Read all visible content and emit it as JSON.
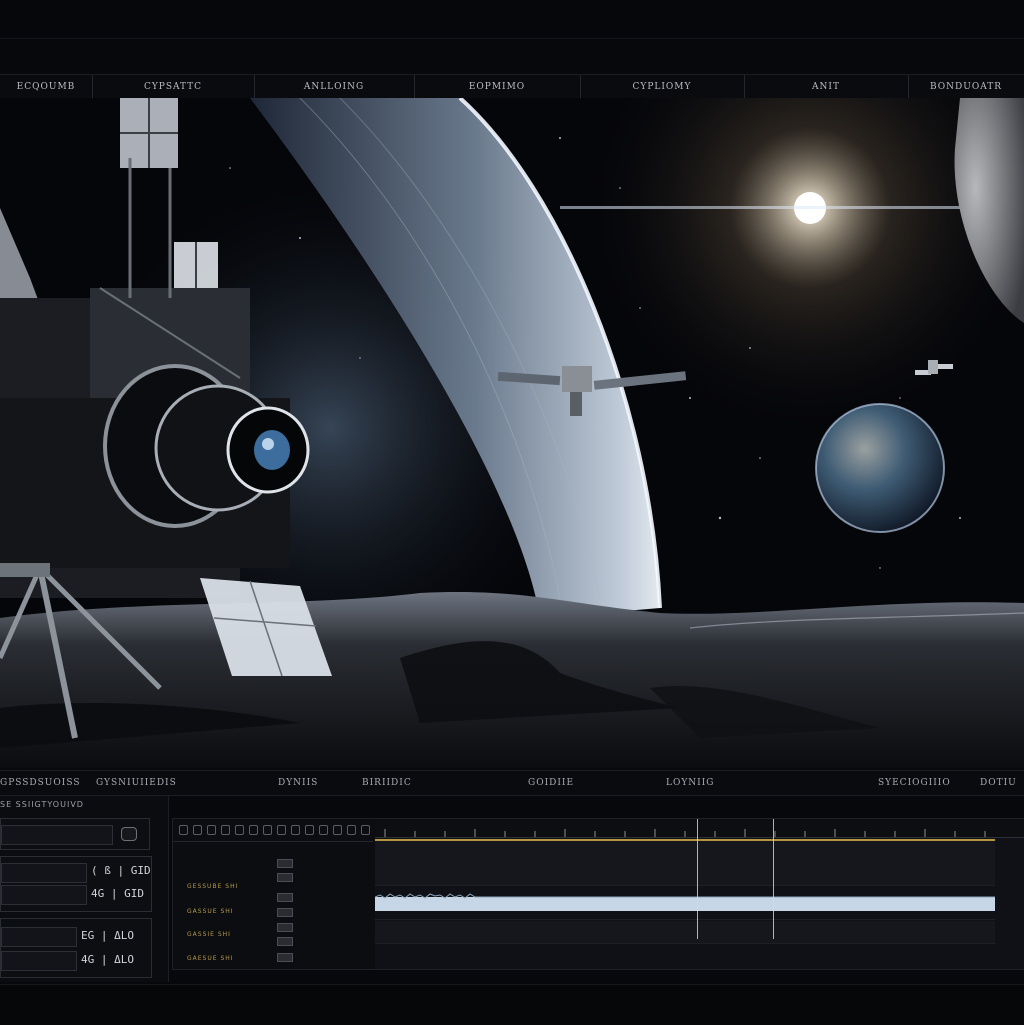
{
  "tabs": [
    {
      "label": "ECQOUMB"
    },
    {
      "label": "CYPSATTC"
    },
    {
      "label": "ANLLOING"
    },
    {
      "label": "EOPMIMO"
    },
    {
      "label": "CYPLIOMY"
    },
    {
      "label": "ANIT"
    },
    {
      "label": "BONDUOATR"
    }
  ],
  "track_labels": [
    {
      "label": "GPSSDSUOISS"
    },
    {
      "label": "GYSNIUIIEDIS"
    },
    {
      "label": "DYNIIS"
    },
    {
      "label": "BIRIIDIC"
    },
    {
      "label": "GOIDIIE"
    },
    {
      "label": "LOYNIIG"
    },
    {
      "label": "SYECIOGIIIO"
    },
    {
      "label": "DOTIU"
    }
  ],
  "panel": {
    "title": "SE SSIIGTYOUIVD",
    "row1_value": "( ß | GID",
    "row2_value": "4G | GID",
    "row3_value": "EG | ΔLO",
    "row4_value": "4G | ΔLO"
  },
  "tracks": [
    {
      "name": "GESSUBE SHI"
    },
    {
      "name": "GASSUE SHI"
    },
    {
      "name": "GASSIE SHI"
    },
    {
      "name": "GAESUE SHI"
    }
  ],
  "colors": {
    "accent_gold": "#b5953d",
    "waveform": "#c7d6e6",
    "panel_bg": "#0b0c10"
  },
  "icons": [
    "camera-icon",
    "satellite-icon",
    "planet-icon"
  ]
}
